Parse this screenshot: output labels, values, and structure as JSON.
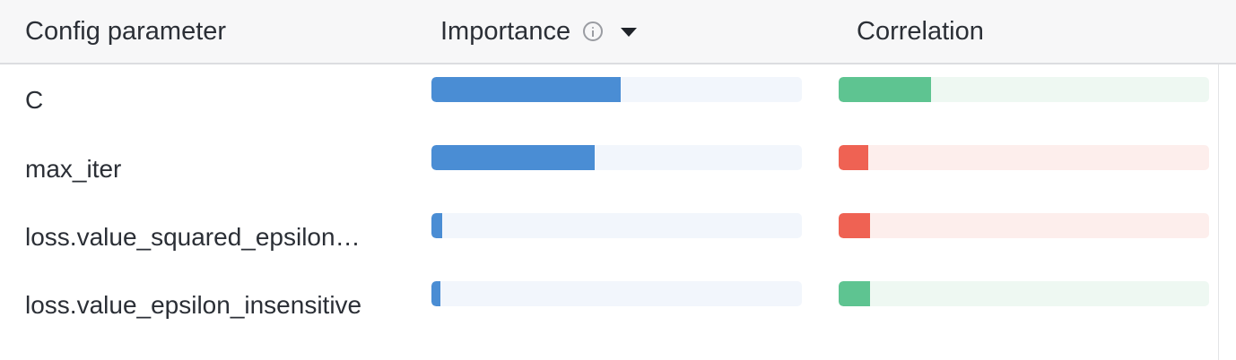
{
  "header": {
    "param_label": "Config parameter",
    "importance_label": "Importance",
    "correlation_label": "Correlation"
  },
  "colors": {
    "importance_fill": "#4a8dd4",
    "importance_track": "#f2f6fc",
    "positive_fill": "#5ec491",
    "positive_track": "#eef8f2",
    "negative_fill": "#ef6253",
    "negative_track": "#fdeeec"
  },
  "rows": [
    {
      "name": "C",
      "importance": 0.51,
      "correlation_strength": 0.25,
      "correlation_sign": "positive"
    },
    {
      "name": "max_iter",
      "importance": 0.44,
      "correlation_strength": 0.08,
      "correlation_sign": "negative"
    },
    {
      "name": "loss.value_squared_epsilon…",
      "importance": 0.03,
      "correlation_strength": 0.085,
      "correlation_sign": "negative"
    },
    {
      "name": "loss.value_epsilon_insensitive",
      "importance": 0.025,
      "correlation_strength": 0.085,
      "correlation_sign": "positive"
    }
  ]
}
